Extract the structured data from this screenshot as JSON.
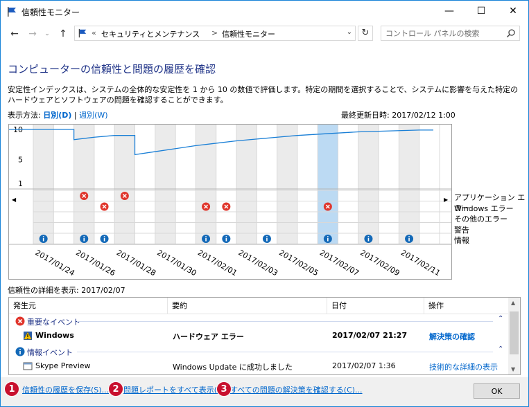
{
  "window": {
    "title": "信頼性モニター",
    "minimize": "—",
    "maximize": "☐",
    "close": "✕"
  },
  "address": {
    "prefix": "«",
    "crumb1": "セキュリティとメンテナンス",
    "sep": ">",
    "crumb2": "信頼性モニター"
  },
  "search": {
    "placeholder": "コントロール パネルの検索"
  },
  "heading": "コンピューターの信頼性と問題の履歴を確認",
  "description": "安定性インデックスは、システムの全体的な安定性を 1 から 10 の数値で評価します。特定の期間を選択することで、システムに影響を与えた特定のハードウェアとソフトウェアの問題を確認することができます。",
  "view": {
    "label": "表示方法:",
    "daily": "日別(D)",
    "sep": "|",
    "weekly": "週別(W)"
  },
  "last_updated": "最終更新日時: 2017/02/12 1:00",
  "chart_data": {
    "type": "line",
    "y_ticks": [
      10,
      5,
      1
    ],
    "ylim": [
      1,
      10
    ],
    "dates": [
      "2017/01/24",
      "2017/01/26",
      "2017/01/28",
      "2017/01/30",
      "2017/02/01",
      "2017/02/03",
      "2017/02/05",
      "2017/02/07",
      "2017/02/09",
      "2017/02/11"
    ],
    "stability_index": [
      {
        "day": "2017/01/23",
        "value": 10.0
      },
      {
        "day": "2017/01/24",
        "value": 10.0
      },
      {
        "day": "2017/01/25",
        "value": 10.0
      },
      {
        "day": "2017/01/26",
        "value": 8.3
      },
      {
        "day": "2017/01/27",
        "value": 8.7
      },
      {
        "day": "2017/01/28",
        "value": 9.0
      },
      {
        "day": "2017/01/29",
        "value": 5.8
      },
      {
        "day": "2017/01/30",
        "value": 6.3
      },
      {
        "day": "2017/01/31",
        "value": 6.8
      },
      {
        "day": "2017/02/01",
        "value": 7.3
      },
      {
        "day": "2017/02/02",
        "value": 7.7
      },
      {
        "day": "2017/02/03",
        "value": 8.1
      },
      {
        "day": "2017/02/04",
        "value": 8.4
      },
      {
        "day": "2017/02/05",
        "value": 8.7
      },
      {
        "day": "2017/02/06",
        "value": 9.0
      },
      {
        "day": "2017/02/07",
        "value": 9.2
      },
      {
        "day": "2017/02/08",
        "value": 9.4
      },
      {
        "day": "2017/02/09",
        "value": 9.6
      },
      {
        "day": "2017/02/10",
        "value": 9.7
      },
      {
        "day": "2017/02/11",
        "value": 9.8
      },
      {
        "day": "2017/02/12",
        "value": 9.9
      }
    ],
    "selected_day": "2017/02/07",
    "events": {
      "app_errors": [
        "2017/01/26",
        "2017/01/28"
      ],
      "windows_errors": [
        "2017/01/27",
        "2017/02/01",
        "2017/02/02",
        "2017/02/07"
      ],
      "info": [
        "2017/01/24",
        "2017/01/26",
        "2017/01/27",
        "2017/02/01",
        "2017/02/02",
        "2017/02/04",
        "2017/02/07",
        "2017/02/09",
        "2017/02/11"
      ]
    },
    "legend": [
      "アプリケーション エラー",
      "Windows エラー",
      "その他のエラー",
      "警告",
      "情報"
    ]
  },
  "details_label": "信頼性の詳細を表示: 2017/02/07",
  "table": {
    "columns": [
      "発生元",
      "要約",
      "日付",
      "操作"
    ],
    "groups": {
      "critical": "重要なイベント",
      "info": "情報イベント"
    },
    "rows": [
      {
        "source": "Windows",
        "summary": "ハードウェア エラー",
        "date": "2017/02/07 21:27",
        "action": "解決策の確認",
        "bold": true
      },
      {
        "source": "Skype Preview",
        "summary": "Windows Update に成功しました",
        "date": "2017/02/07 1:36",
        "action": "技術的な詳細の表示",
        "bold": false
      }
    ]
  },
  "footer": {
    "save": "信頼性の履歴を保存(S)...",
    "reports": "問題レポートをすべて表示(R)",
    "solutions": "すべての問題の解決策を確認する(C)...",
    "ok": "OK"
  },
  "badges": [
    "1",
    "2",
    "3"
  ],
  "colors": {
    "line": "#1a7fd6",
    "error": "#e0352b",
    "info": "#1369b8",
    "heading": "#1e3287",
    "link": "#0066cc",
    "selected": "#bcdaf3",
    "badge": "#c8102e"
  }
}
